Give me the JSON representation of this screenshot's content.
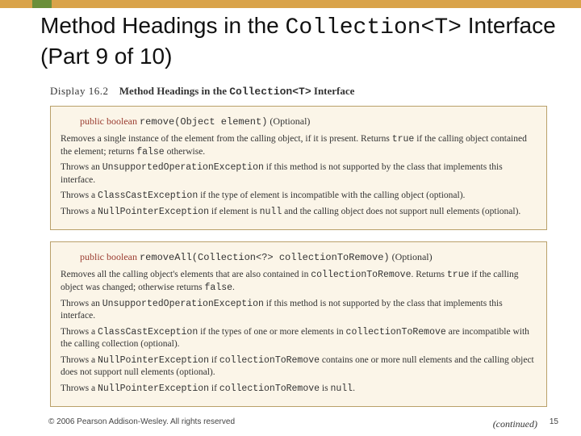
{
  "title": {
    "prefix": "Method Headings in the ",
    "code": "Collection<T>",
    "suffix": " Interface (Part 9 of 10)"
  },
  "display": {
    "label": "Display 16.2",
    "title_prefix": "Method Headings in the ",
    "title_code": "Collection<T>",
    "title_suffix": " Interface"
  },
  "box1": {
    "sig_kw": "public boolean",
    "sig_code": "remove(Object element)",
    "sig_opt": "(Optional)",
    "p1a": "Removes a single instance of the element from the calling object, if it is present. Returns ",
    "p1b": " if the calling object contained the element; returns ",
    "p1c": " otherwise.",
    "true": "true",
    "false": "false",
    "p2a": "Throws an ",
    "ex1": "UnsupportedOperationException",
    "p2b": " if this method is not supported by the class that implements this interface.",
    "p3a": "Throws a ",
    "ex2": "ClassCastException",
    "p3b": " if the type of element is incompatible with the calling object (optional).",
    "p4a": "Throws a ",
    "ex3": "NullPointerException",
    "p4b": " if element is ",
    "null": "null",
    "p4c": " and the calling object does not support null elements (optional)."
  },
  "box2": {
    "sig_kw": "public boolean",
    "sig_code": "removeAll(Collection<?> collectionToRemove)",
    "sig_opt": "(Optional)",
    "p1a": "Removes all the calling object's elements that are also contained in ",
    "arg": "collectionToRemove",
    "p1b": ". Returns ",
    "true": "true",
    "p1c": " if the calling object was changed; otherwise returns ",
    "false": "false",
    "p1d": ".",
    "p2a": "Throws an ",
    "ex1": "UnsupportedOperationException",
    "p2b": " if this method is not supported by the class that implements this interface.",
    "p3a": "Throws a ",
    "ex2": "ClassCastException",
    "p3b": " if the types of one or more elements in ",
    "p3c": " are incompatible with the calling collection (optional).",
    "p4a": "Throws a ",
    "ex3": "NullPointerException",
    "p4b": " if ",
    "p4c": " contains one or more null elements and the calling object does not support null elements (optional).",
    "p5a": "Throws a ",
    "ex4": "NullPointerException",
    "p5b": " if ",
    "p5c": " is ",
    "null": "null",
    "p5d": "."
  },
  "continued": "(continued)",
  "footer": {
    "copyright": "© 2006 Pearson Addison-Wesley. All rights reserved",
    "page": "15"
  }
}
